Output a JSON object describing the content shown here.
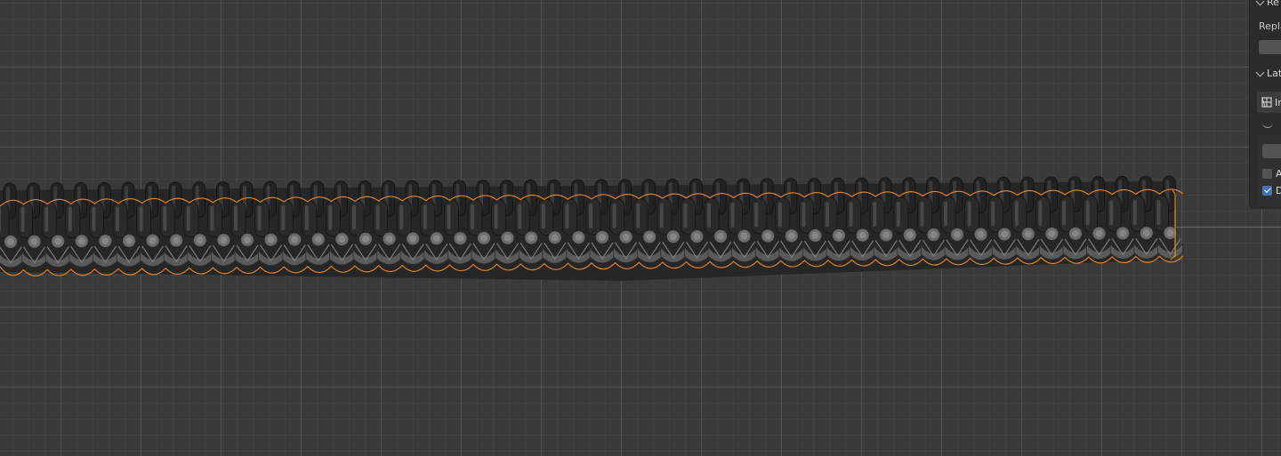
{
  "viewport": {
    "name": "3d-viewport",
    "object": "lattice-chain-belt",
    "colors": {
      "background": "#3a3a3a",
      "selection_outline": "#e8892f",
      "mesh_dark": "#1f1f1f",
      "mesh_light": "#707070"
    }
  },
  "npanel": {
    "sections": [
      {
        "label": "Re",
        "expanded": true
      },
      {
        "label": "Lat",
        "expanded": true
      }
    ],
    "replace_label": "Repla",
    "lattice_button_label": "In",
    "lattice_button_icon": "lattice-grid-icon",
    "checkboxes": [
      {
        "label": "A",
        "checked": false
      },
      {
        "label": "D",
        "checked": true
      }
    ]
  }
}
